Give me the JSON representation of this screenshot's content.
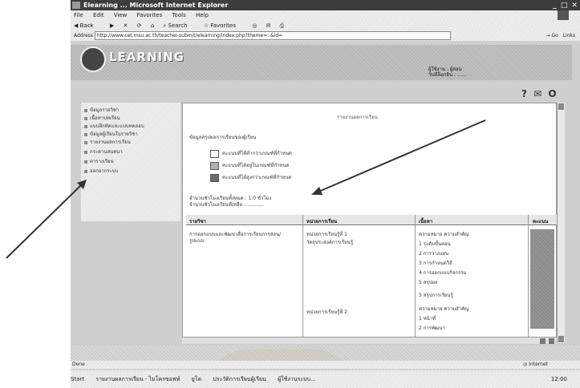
{
  "window": {
    "title": "Elearning ... Microsoft Internet Explorer",
    "controls": "_ □ ✕"
  },
  "menubar": {
    "items": [
      "File",
      "Edit",
      "View",
      "Favorites",
      "Tools",
      "Help"
    ]
  },
  "toolbar": {
    "back": "Back",
    "search": "Search",
    "favorites": "Favorites"
  },
  "address": {
    "label": "Address",
    "url": "http://www.cet.msu.ac.th/teacher-submit/elearning/index.php?theme=..&id=",
    "go": "Go",
    "links": "Links"
  },
  "banner": {
    "logo_text": "LEARNING",
    "user_line1": "ผู้ใช้งาน : ผู้สอน",
    "user_line2": "วันที่ล็อกอิน : ......"
  },
  "corner_icons": "?  ✉  O",
  "sidebar": {
    "items": [
      "ข้อมูลรายวิชา",
      "เนื้อหาบทเรียน",
      "แบบฝึกหัดและแบบทดสอบ",
      "ข้อมูลผู้เรียนในรายวิชา",
      "รายงานผลการเรียน",
      "กระดานสนทนา",
      "ตารางเรียน",
      "ออกจากระบบ"
    ]
  },
  "content": {
    "title": "รายงานผลการเรียน",
    "section_head": "ข้อมูลสรุปผลการเรียนของผู้เรียน",
    "legend": [
      {
        "label": "คะแนนที่ได้ต่ำกว่าเกณฑ์ที่กำหนด",
        "color": "#ffffff"
      },
      {
        "label": "คะแนนที่ได้อยู่ในเกณฑ์ที่กำหนด",
        "color": "#b0b0b0"
      },
      {
        "label": "คะแนนที่ได้สูงกว่าเกณฑ์ที่กำหนด",
        "color": "#6a6a6a"
      }
    ],
    "stats_line1": "จำนวนชั่วโมงเรียนทั้งหมด : 1.0 ชั่วโมง",
    "stats_line2": "จำนวนชั่วโมงเรียนที่เหลือ : ...........",
    "table": {
      "headers": [
        "รายวิชา",
        "หน่วยการเรียน",
        "เนื้อหา",
        "คะแนน"
      ],
      "course": "การออกแบบและพัฒนาสื่อการเรียนการสอน/",
      "course2": "รูปแบบ",
      "units": [
        "หน่วยการเรียนรู้ที่ 1",
        "หน่วยการเรียนรู้ที่ 2"
      ],
      "unit_sub": "วัตถุประสงค์การเรียนรู้",
      "contents": [
        "ความหมาย ความสำคัญ",
        "1 ระดับขั้นตอน",
        "2 การวางแผน",
        "3 การกำหนดวิธี",
        "4 การออกแบบกิจกรรม",
        "5 สรุปผล",
        "5 สรุปการเรียนรู้",
        "ความหมาย ความสำคัญ",
        "1 หน้าที่",
        "2 การพัฒนา"
      ]
    }
  },
  "status": {
    "left": "Done",
    "zone": "Internet"
  },
  "taskbar": {
    "start": "Start",
    "items": [
      "รายงานผลการเรียน - ไมโครซอฟท์",
      "ยูโด",
      "ประวัติการเรียนผู้เรียน",
      "ผู้ใช้งานระบบ..."
    ],
    "tray": "12:00"
  }
}
